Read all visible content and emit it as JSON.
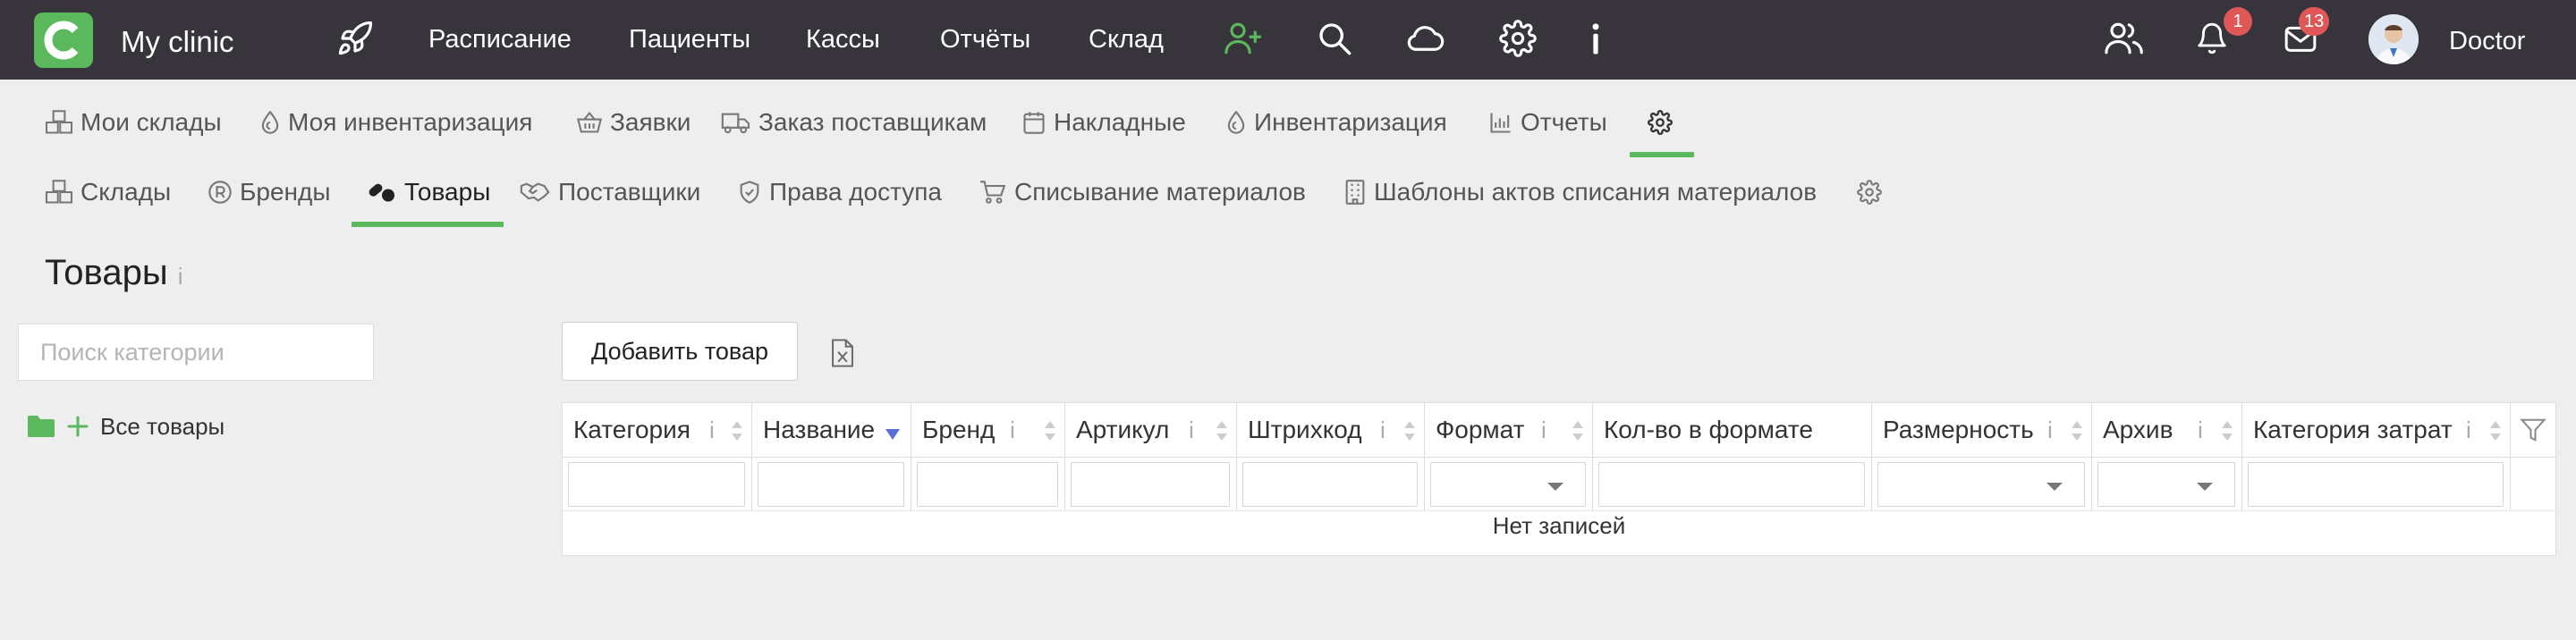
{
  "app": {
    "title": "My clinic",
    "user": "Doctor"
  },
  "topnav": {
    "items": [
      "Расписание",
      "Пациенты",
      "Кассы",
      "Отчёты",
      "Склад"
    ],
    "notifications_count": "1",
    "messages_count": "13"
  },
  "subnav1": {
    "items": [
      "Мои склады",
      "Моя инвентаризация",
      "Заявки",
      "Заказ поставщикам",
      "Накладные",
      "Инвентаризация",
      "Отчеты"
    ]
  },
  "subnav2": {
    "items": [
      "Склады",
      "Бренды",
      "Товары",
      "Поставщики",
      "Права доступа",
      "Списывание материалов",
      "Шаблоны актов списания материалов"
    ],
    "active": "Товары"
  },
  "page": {
    "title": "Товары",
    "info": "i",
    "search_placeholder": "Поиск категории",
    "tree_all": "Все товары",
    "add_button": "Добавить товар"
  },
  "grid": {
    "columns": [
      "Категория",
      "Название",
      "Бренд",
      "Артикул",
      "Штрихкод",
      "Формат",
      "Кол-во в формате",
      "Размерность",
      "Архив",
      "Категория затрат"
    ],
    "empty_text": "Нет записей"
  },
  "colors": {
    "accent": "#5cb85c",
    "topbar": "#37343b",
    "badge": "#e05757",
    "background": "#eeeeee"
  }
}
